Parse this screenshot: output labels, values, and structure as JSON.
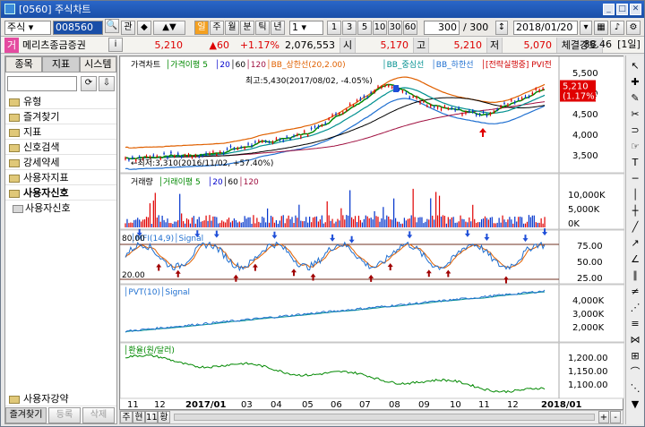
{
  "window": {
    "title": "[0560] 주식차트",
    "min_icon": "minimize-icon",
    "max_icon": "maximize-icon",
    "close_icon": "close-icon"
  },
  "toolbar": {
    "market": "주식",
    "code": "008560",
    "btn_gwan": "관",
    "period_buttons": [
      "주",
      "월",
      "분",
      "틱",
      "년"
    ],
    "selected_period": "일",
    "interval_value": "1",
    "interval_buttons": [
      "1",
      "3",
      "5",
      "10",
      "30",
      "60"
    ],
    "count_value": "300",
    "count_total": "/ 300",
    "date_value": "2018/01/20"
  },
  "stock": {
    "badge": "거",
    "name": "메리츠종금증권",
    "info": "i",
    "price": "5,210",
    "change": "▲60",
    "change_pct": "+1.17%",
    "volume": "2,076,553",
    "open_label": "시",
    "open": "5,170",
    "high_label": "고",
    "high": "5,210",
    "low_label": "저",
    "low": "5,070",
    "strength_label": "체결강도",
    "strength": "88.46",
    "period_tag": "[1일]"
  },
  "sidebar": {
    "tabs": [
      "종목",
      "지표",
      "시스템"
    ],
    "items": [
      "유형",
      "즐겨찾기",
      "지표",
      "신호검색",
      "강세약세",
      "사용자지표",
      "사용자신호",
      "사용자신호",
      "사용자강약"
    ],
    "bottom_buttons": [
      "즐겨찾기",
      "등록",
      "삭제"
    ]
  },
  "legend": {
    "main": [
      "가격차트",
      "가격이평 5",
      "20",
      "60",
      "120",
      "BB_상한선(20,2.00)",
      "BB_중심선",
      "BB_하한선",
      "[전략실행중] PVI전"
    ],
    "volume": [
      "거래량",
      "거래이평 5",
      "20",
      "60",
      "120"
    ],
    "mfi": [
      "MFI(14,9)",
      "Signal"
    ],
    "pvt": [
      "PVT(10)",
      "Signal"
    ],
    "fx": [
      "환율(원/달러)"
    ]
  },
  "annotations": {
    "max": "최고:5,430(2017/08/02, -4.05%)",
    "min": "최저:3,310(2016/11/02, +57.40%)",
    "mfi_top": "80.00",
    "mfi_bot": "20.00"
  },
  "price_axis": [
    "5,500",
    "5,000",
    "4,500",
    "4,000",
    "3,500"
  ],
  "price_tag": {
    "value": "5,210",
    "pct": "(1.17%)"
  },
  "volume_axis": [
    "10,000K",
    "5,000K",
    "0K"
  ],
  "mfi_axis": [
    "75.00",
    "50.00",
    "25.00"
  ],
  "pvt_axis": [
    "4,000K",
    "3,000K",
    "2,000K"
  ],
  "fx_axis": [
    "1,200.00",
    "1,150.00",
    "1,100.00"
  ],
  "x_axis": [
    "11",
    "12",
    "2017/01",
    "03",
    "04",
    "05",
    "06",
    "07",
    "08",
    "09",
    "10",
    "11",
    "12",
    "2018/01"
  ],
  "bottom_tabs": [
    "주",
    "현",
    "11",
    "황"
  ],
  "colors": {
    "accent": "#1a4fa8",
    "up": "#e00000",
    "down": "#0033cc",
    "ma5": "#008800",
    "ma20": "#0000cc",
    "ma60": "#000000",
    "bb": "#e06000"
  }
}
